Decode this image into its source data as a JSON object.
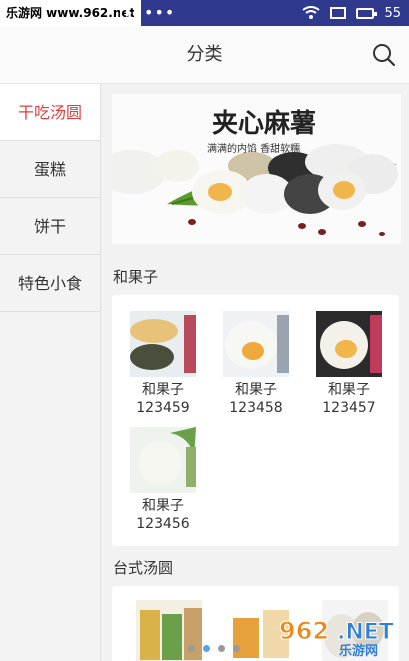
{
  "statusbar": {
    "site_badge": "乐游网 www.962.net",
    "battery": "55"
  },
  "header": {
    "title": "分类"
  },
  "sidebar": {
    "items": [
      {
        "label": "干吃汤圆",
        "active": true
      },
      {
        "label": "蛋糕",
        "active": false
      },
      {
        "label": "饼干",
        "active": false
      },
      {
        "label": "特色小食",
        "active": false
      }
    ]
  },
  "banner": {
    "brand_text": "夹心麻薯",
    "slogan": "满满的内馅 香甜软糯"
  },
  "sections": [
    {
      "title": "和果子",
      "products": [
        {
          "name": "和果子",
          "code": "123459"
        },
        {
          "name": "和果子",
          "code": "123458"
        },
        {
          "name": "和果子",
          "code": "123457"
        },
        {
          "name": "和果子",
          "code": "123456"
        }
      ]
    },
    {
      "title": "台式汤圆",
      "products": []
    }
  ],
  "pager": {
    "count": 4,
    "active_index": 1
  },
  "watermark": {
    "brand": "962.NET",
    "sub": "乐游网"
  },
  "colors": {
    "statusbar": "#2f3a8f",
    "active_red": "#e04040",
    "pager_active": "#5aa0e8"
  }
}
